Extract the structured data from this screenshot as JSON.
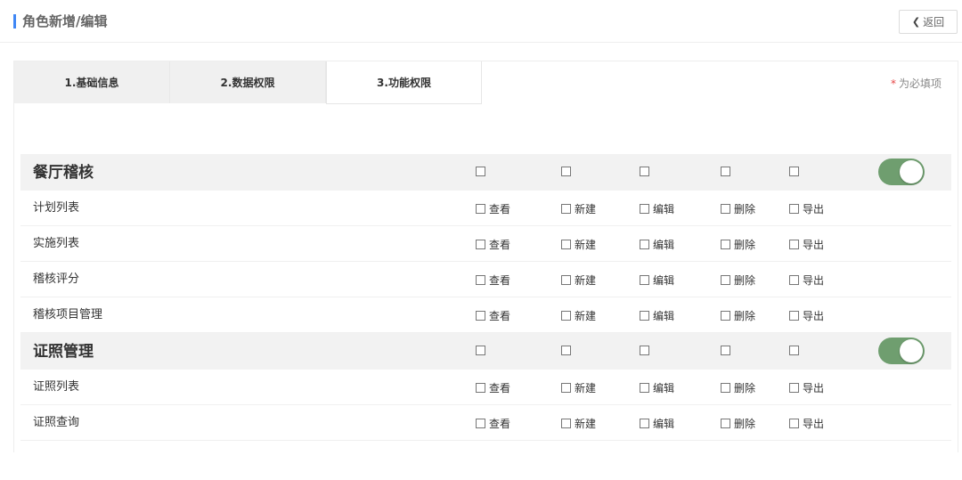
{
  "header": {
    "title": "角色新增/编辑",
    "back_label": "返回",
    "back_icon": "chevron-left-icon"
  },
  "tabs": [
    {
      "label": "1.基础信息"
    },
    {
      "label": "2.数据权限"
    },
    {
      "label": "3.功能权限",
      "active": true
    }
  ],
  "required_note": {
    "star": "*",
    "text": "为必填项"
  },
  "actions": [
    "查看",
    "新建",
    "编辑",
    "删除",
    "导出"
  ],
  "colors": {
    "accent": "#3f87f5",
    "toggle_on": "#6f9e6f",
    "required_star": "#e64545",
    "group_bg": "#f2f2f2"
  },
  "groups": [
    {
      "name": "餐厅稽核",
      "toggle_on": true,
      "items": [
        {
          "name": "计划列表",
          "actions": [
            "查看",
            "新建",
            "编辑",
            "删除",
            "导出"
          ]
        },
        {
          "name": "实施列表",
          "actions": [
            "查看",
            "新建",
            "编辑",
            "删除",
            "导出"
          ]
        },
        {
          "name": "稽核评分",
          "actions": [
            "查看",
            "新建",
            "编辑",
            "删除",
            "导出"
          ]
        },
        {
          "name": "稽核项目管理",
          "actions": [
            "查看",
            "新建",
            "编辑",
            "删除",
            "导出"
          ]
        }
      ]
    },
    {
      "name": "证照管理",
      "toggle_on": true,
      "items": [
        {
          "name": "证照列表",
          "actions": [
            "查看",
            "新建",
            "编辑",
            "删除",
            "导出"
          ]
        },
        {
          "name": "证照查询",
          "actions": [
            "查看",
            "新建",
            "编辑",
            "删除",
            "导出"
          ]
        }
      ]
    }
  ]
}
